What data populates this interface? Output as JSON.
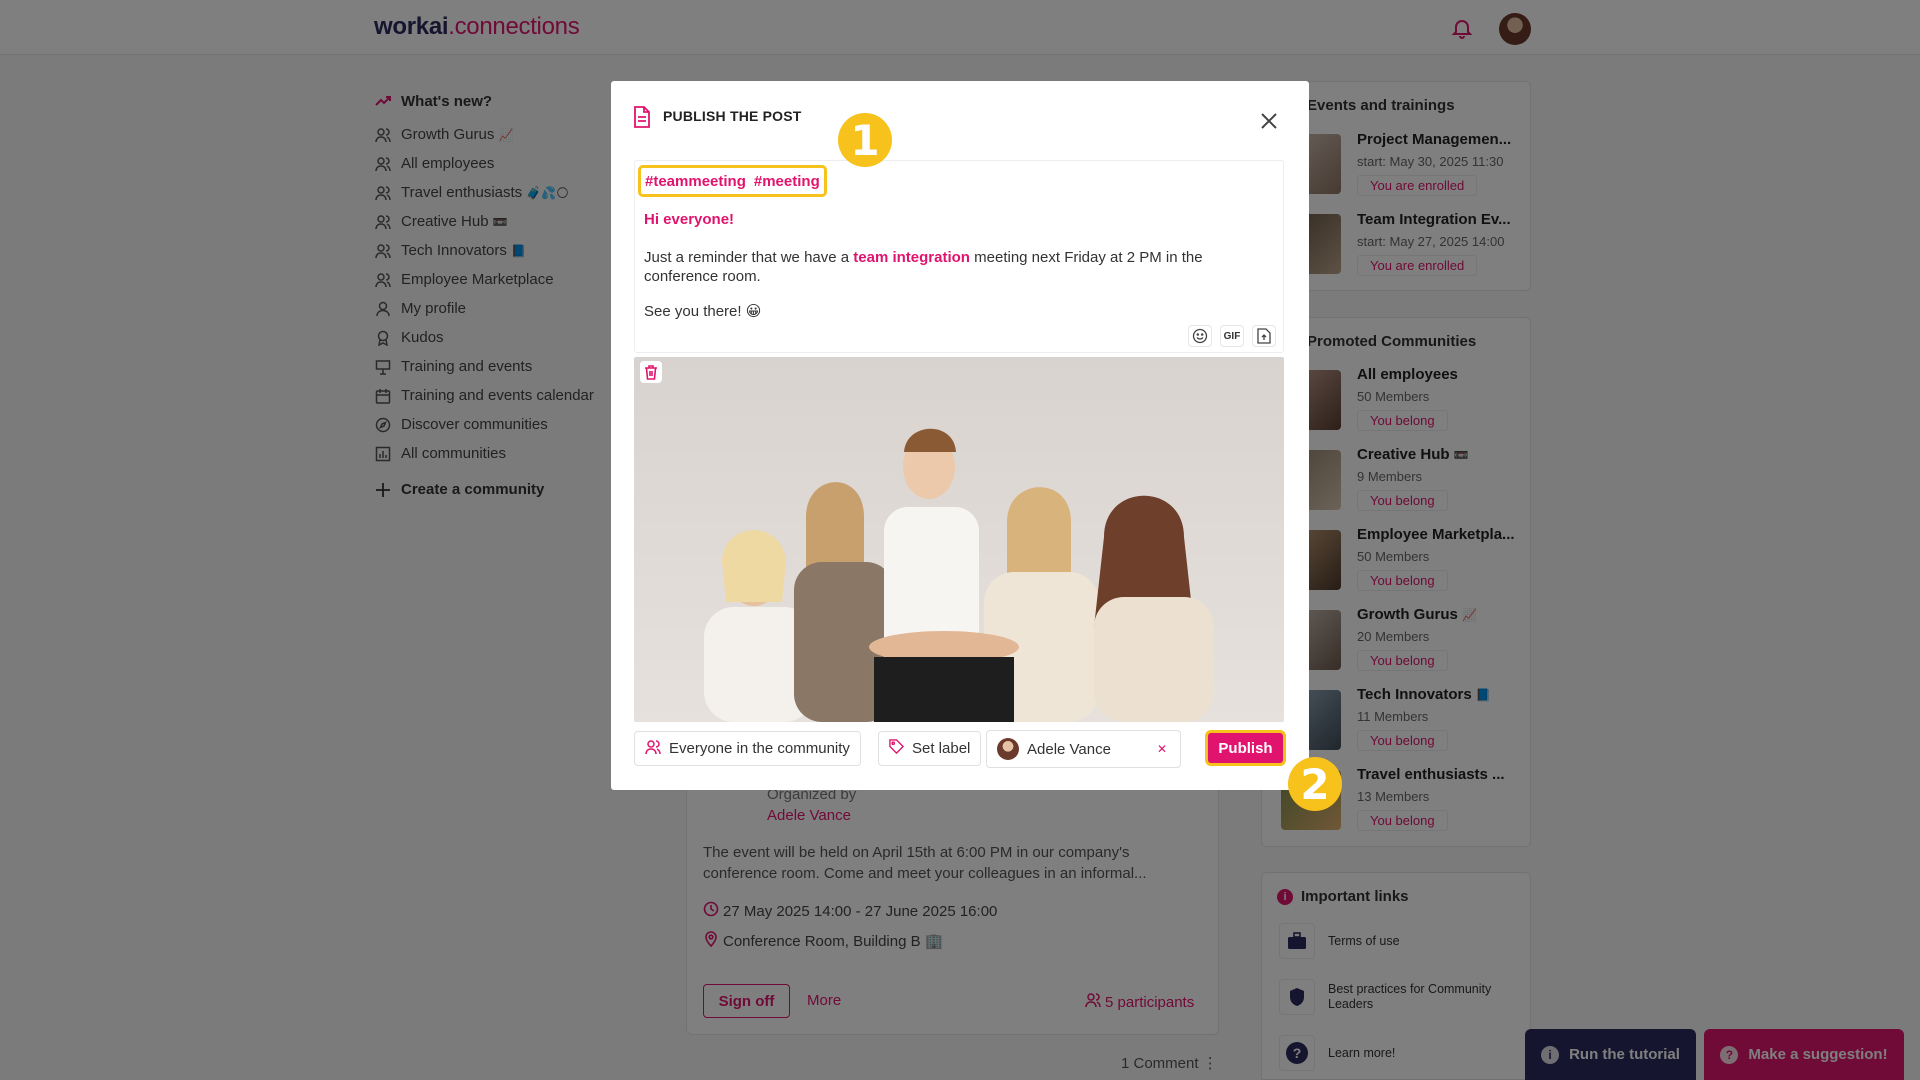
{
  "app": {
    "logo_part1": "workai",
    "logo_part2": ".connections"
  },
  "leftnav": {
    "items": [
      {
        "label": "What's new?",
        "icon": "trending-icon",
        "emoji": ""
      },
      {
        "label": "Growth Gurus",
        "icon": "users-icon",
        "emoji": "📈"
      },
      {
        "label": "All employees",
        "icon": "users-icon",
        "emoji": ""
      },
      {
        "label": "Travel enthusiasts",
        "icon": "users-icon",
        "emoji": "🧳💦🌕"
      },
      {
        "label": "Creative Hub",
        "icon": "users-icon",
        "emoji": "📼"
      },
      {
        "label": "Tech Innovators",
        "icon": "users-icon",
        "emoji": "📘"
      },
      {
        "label": "Employee Marketplace",
        "icon": "users-icon",
        "emoji": ""
      },
      {
        "label": "My profile",
        "icon": "user-icon",
        "emoji": ""
      },
      {
        "label": "Kudos",
        "icon": "award-icon",
        "emoji": ""
      },
      {
        "label": "Training and events",
        "icon": "presentation-icon",
        "emoji": ""
      },
      {
        "label": "Training and events calendar",
        "icon": "calendar-icon",
        "emoji": ""
      },
      {
        "label": "Discover communities",
        "icon": "compass-icon",
        "emoji": ""
      },
      {
        "label": "All communities",
        "icon": "chart-icon",
        "emoji": ""
      }
    ],
    "create_label": "Create a community"
  },
  "feed": {
    "organized_by": "Organized by",
    "organizer": "Adele Vance",
    "description": "The event will be held on April 15th at 6:00 PM in our company's conference room. Come and meet your colleagues in an informal...",
    "date_range": "27 May 2025 14:00 - 27 June 2025 16:00",
    "location": "Conference Room, Building B 🏢",
    "signoff_label": "Sign off",
    "more_label": "More",
    "participants": "5 participants",
    "comments": "1 Comment"
  },
  "events": {
    "title": "Events and trainings",
    "items": [
      {
        "name": "Project Managemen...",
        "start": "start: May 30, 2025 11:30",
        "status": "You are enrolled"
      },
      {
        "name": "Team Integration Ev...",
        "start": "start: May 27, 2025 14:00",
        "status": "You are enrolled"
      }
    ]
  },
  "promoted": {
    "title": "Promoted Communities",
    "items": [
      {
        "name": "All employees",
        "members": "50 Members",
        "status": "You belong",
        "emoji": ""
      },
      {
        "name": "Creative Hub",
        "members": "9 Members",
        "status": "You belong",
        "emoji": "📼"
      },
      {
        "name": "Employee Marketpla...",
        "members": "50 Members",
        "status": "You belong",
        "emoji": ""
      },
      {
        "name": "Growth Gurus",
        "members": "20 Members",
        "status": "You belong",
        "emoji": "📈"
      },
      {
        "name": "Tech Innovators",
        "members": "11 Members",
        "status": "You belong",
        "emoji": "📘"
      },
      {
        "name": "Travel enthusiasts ...",
        "members": "13 Members",
        "status": "You belong",
        "emoji": ""
      }
    ]
  },
  "links": {
    "title": "Important links",
    "items": [
      {
        "label": "Terms of use",
        "icon": "briefcase-icon"
      },
      {
        "label": "Best practices for Community Leaders",
        "icon": "shield-icon"
      },
      {
        "label": "Learn more!",
        "icon": "question-icon"
      }
    ]
  },
  "bottom": {
    "tutorial_label": "Run the tutorial",
    "suggest_label": "Make a suggestion!"
  },
  "modal": {
    "title": "PUBLISH THE POST",
    "tags": [
      "#teammeeting",
      "#meeting"
    ],
    "greeting": "Hi everyone!",
    "body_before": "Just a reminder that we have a ",
    "body_highlight": "team integration",
    "body_after": " meeting next Friday at 2 PM in the conference room.",
    "closing": "See you there! 😀",
    "gif_label": "GIF",
    "audience_label": "Everyone in the community",
    "label_button": "Set label",
    "author": "Adele Vance",
    "publish_label": "Publish",
    "markers": [
      "1",
      "2"
    ]
  },
  "colors": {
    "accent": "#e0146e",
    "brand_dark": "#2b2a5e",
    "highlight": "#f6c21b"
  }
}
